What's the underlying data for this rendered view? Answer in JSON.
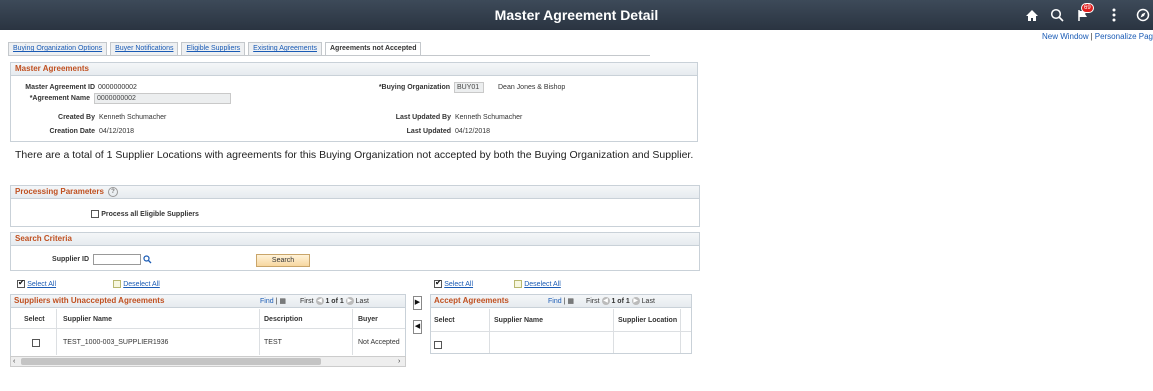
{
  "header": {
    "title": "Master Agreement Detail",
    "notification_count": "69"
  },
  "toplinks": {
    "new_window": "New Window",
    "personalize": "Personalize Pag"
  },
  "tabs": [
    {
      "label": "Buying Organization Options",
      "active": false
    },
    {
      "label": "Buyer Notifications",
      "active": false
    },
    {
      "label": "Eligible Suppliers",
      "active": false
    },
    {
      "label": "Existing Agreements",
      "active": false
    },
    {
      "label": "Agreements not Accepted",
      "active": true
    }
  ],
  "master": {
    "section_title": "Master Agreements",
    "agreement_id_label": "Master Agreement ID",
    "agreement_id": "0000000002",
    "agreement_name_label": "*Agreement Name",
    "agreement_name": "0000000002",
    "created_by_label": "Created By",
    "created_by": "Kenneth Schumacher",
    "creation_date_label": "Creation Date",
    "creation_date": "04/12/2018",
    "buying_org_label": "*Buying Organization",
    "buying_org_code": "BUY01",
    "buying_org_name": "Dean Jones & Bishop",
    "last_updated_by_label": "Last Updated By",
    "last_updated_by": "Kenneth Schumacher",
    "last_updated_label": "Last Updated",
    "last_updated": "04/12/2018"
  },
  "info_text": "There are a total of 1 Supplier Locations with agreements for this Buying Organization not accepted by both the Buying Organization and Supplier.",
  "processing": {
    "title": "Processing Parameters",
    "help": "?",
    "checkbox_label": "Process all Eligible Suppliers"
  },
  "search": {
    "title": "Search Criteria",
    "supplier_id_label": "Supplier ID",
    "supplier_id_value": "",
    "search_button": "Search"
  },
  "left_grid": {
    "select_all": "Select All",
    "deselect_all": "Deselect All",
    "title": "Suppliers with Unaccepted Agreements",
    "find": "Find",
    "sep": "|",
    "first": "First",
    "range": "1 of 1",
    "last": "Last",
    "columns": [
      "Select",
      "Supplier Name",
      "Description",
      "Buyer"
    ],
    "rows": [
      {
        "supplier_name": "TEST_1000-003_SUPPLIER1936",
        "description": "TEST",
        "buyer": "Not Accepted"
      }
    ]
  },
  "right_grid": {
    "select_all": "Select All",
    "deselect_all": "Deselect All",
    "title": "Accept Agreements",
    "find": "Find",
    "sep": "|",
    "first": "First",
    "range": "1 of 1",
    "last": "Last",
    "columns": [
      "Select",
      "Supplier Name",
      "Supplier Location"
    ]
  },
  "icons": {
    "home": "home-icon",
    "search": "search-icon",
    "flag": "notification-flag-icon",
    "more": "more-vertical-icon",
    "compass": "navbar-compass-icon"
  }
}
